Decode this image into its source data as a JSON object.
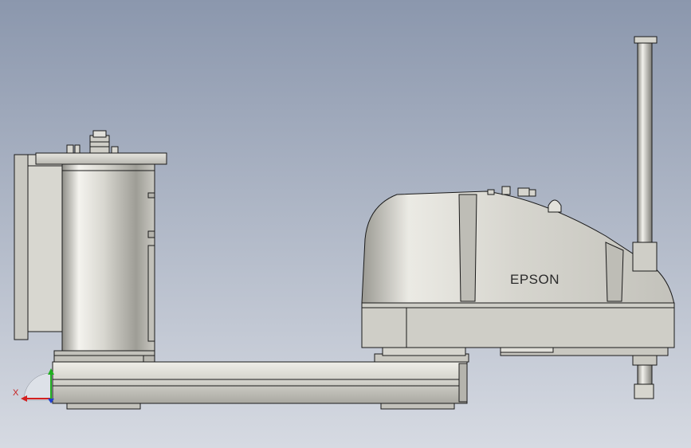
{
  "viewport": {
    "background_top": "#8b97ad",
    "background_bottom": "#d6dae2"
  },
  "model": {
    "brand_label": "EPSON",
    "body_color": "#d9d8d1",
    "edge_color": "#1a1a1a"
  },
  "triad": {
    "x_label": "X",
    "x_color": "#d42020",
    "y_color": "#20b020",
    "z_color": "#2040d0"
  }
}
